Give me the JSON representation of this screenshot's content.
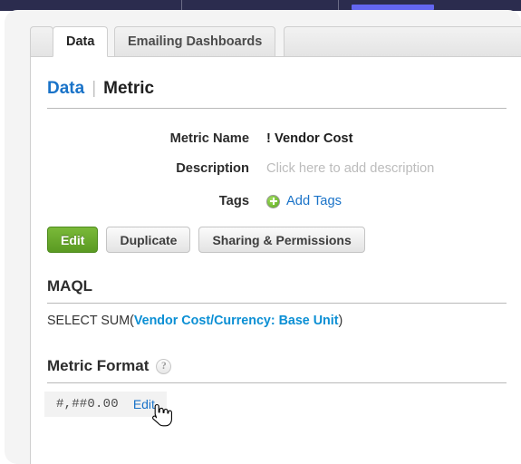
{
  "topbar": {
    "accent_color": "#6366f1",
    "background_color": "#2b2c4e"
  },
  "tabs": [
    {
      "label": "Data",
      "active": true
    },
    {
      "label": "Emailing Dashboards",
      "active": false
    }
  ],
  "breadcrumb": {
    "parent": "Data",
    "separator": "|",
    "current": "Metric"
  },
  "fields": [
    {
      "label": "Metric Name",
      "value": "! Vendor Cost",
      "is_placeholder": false
    },
    {
      "label": "Description",
      "value": "Click here to add description",
      "is_placeholder": true
    }
  ],
  "tags": {
    "label": "Tags",
    "add_label": "Add Tags",
    "icon": "plus-circle-icon"
  },
  "buttons": {
    "edit": "Edit",
    "duplicate": "Duplicate",
    "sharing": "Sharing & Permissions"
  },
  "maql": {
    "heading": "MAQL",
    "prefix": "SELECT SUM(",
    "ref1": "Vendor Cost",
    "slash": "/",
    "ref2": "Currency: Base Unit",
    "suffix": ")"
  },
  "metric_format": {
    "heading": "Metric Format",
    "help_icon": "?",
    "value": "#,##0.00",
    "edit_label": "Edit"
  },
  "colors": {
    "link": "#1a73c8",
    "maql_ref": "#0b8fd4",
    "primary_button": "#6cb52e"
  }
}
